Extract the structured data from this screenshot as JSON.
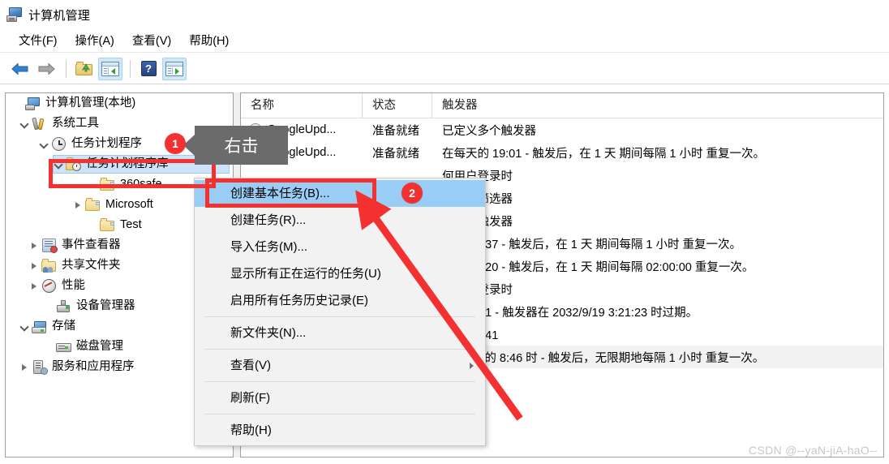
{
  "window": {
    "title": "计算机管理",
    "app_icon": "computer-management-icon"
  },
  "menubar": {
    "items": [
      {
        "label": "文件(F)"
      },
      {
        "label": "操作(A)"
      },
      {
        "label": "查看(V)"
      },
      {
        "label": "帮助(H)"
      }
    ]
  },
  "toolbar": {
    "buttons": [
      {
        "name": "back-icon",
        "label": ""
      },
      {
        "name": "forward-icon",
        "label": ""
      },
      {
        "name": "up-folder-icon",
        "label": ""
      },
      {
        "name": "show-hide-console-tree-icon",
        "label": ""
      },
      {
        "name": "help-icon",
        "label": "?"
      },
      {
        "name": "show-hide-action-pane-icon",
        "label": ""
      }
    ]
  },
  "tree": {
    "items": [
      {
        "label": "计算机管理(本地)",
        "icon": "computer-icon",
        "indent": 0,
        "expander": "none",
        "selected": false
      },
      {
        "label": "系统工具",
        "icon": "system-tools-icon",
        "indent": 1,
        "expander": "down",
        "selected": false
      },
      {
        "label": "任务计划程序",
        "icon": "task-scheduler-clock-icon",
        "indent": 2,
        "expander": "down",
        "selected": false
      },
      {
        "label": "任务计划程序库",
        "icon": "task-scheduler-library-folder-icon",
        "indent": 3,
        "expander": "down",
        "selected": true
      },
      {
        "label": "360safe",
        "icon": "folder-icon",
        "indent": 4,
        "expander": "none",
        "selected": false
      },
      {
        "label": "Microsoft",
        "icon": "folder-icon",
        "indent": 4,
        "expander": "right",
        "selected": false
      },
      {
        "label": "Test",
        "icon": "folder-icon",
        "indent": 4,
        "expander": "none",
        "selected": false
      },
      {
        "label": "事件查看器",
        "icon": "event-viewer-icon",
        "indent": 2,
        "expander": "right",
        "selected": false
      },
      {
        "label": "共享文件夹",
        "icon": "shared-folders-icon",
        "indent": 2,
        "expander": "right",
        "selected": false
      },
      {
        "label": "性能",
        "icon": "performance-icon",
        "indent": 2,
        "expander": "right",
        "selected": false
      },
      {
        "label": "设备管理器",
        "icon": "device-manager-icon",
        "indent": 2,
        "expander": "none",
        "selected": false
      },
      {
        "label": "存储",
        "icon": "storage-icon",
        "indent": 1,
        "expander": "down",
        "selected": false
      },
      {
        "label": "磁盘管理",
        "icon": "disk-management-icon",
        "indent": 2,
        "expander": "none",
        "selected": false
      },
      {
        "label": "服务和应用程序",
        "icon": "services-and-applications-icon",
        "indent": 1,
        "expander": "right",
        "selected": false
      }
    ]
  },
  "list": {
    "columns": [
      {
        "label": "名称"
      },
      {
        "label": "状态"
      },
      {
        "label": "触发器"
      }
    ],
    "rows": [
      {
        "name": "GoogleUpd...",
        "status": "准备就绪",
        "trigger": "已定义多个触发器"
      },
      {
        "name": "GoogleUpd...",
        "status": "准备就绪",
        "trigger": "在每天的 19:01 - 触发后，在 1 天 期间每隔 1 小时 重复一次。"
      },
      {
        "name": "",
        "status": "",
        "trigger": "何用户登录时"
      },
      {
        "name": "",
        "status": "",
        "trigger": "义事件筛选器"
      },
      {
        "name": "",
        "status": "",
        "trigger": "义多个触发器"
      },
      {
        "name": "",
        "status": "",
        "trigger": "天的 20:37 - 触发后，在 1 天 期间每隔 1 小时 重复一次。"
      },
      {
        "name": "",
        "status": "",
        "trigger": "天的 13:20 - 触发后，在 1 天 期间每隔 02:00:00 重复一次。"
      },
      {
        "name": "",
        "status": "",
        "trigger": "何用户登录时"
      },
      {
        "name": "",
        "status": "",
        "trigger": "天的 3:21 - 触发器在 2032/9/19 3:21:23 时过期。"
      },
      {
        "name": "",
        "status": "",
        "trigger": "天的 15:41"
      },
      {
        "name": "",
        "status": "",
        "trigger": "22/9/10 的 8:46 时 - 触发后，无限期地每隔 1 小时 重复一次。"
      }
    ]
  },
  "context_menu": {
    "items": [
      {
        "label": "创建基本任务(B)...",
        "highlighted": true,
        "separator_after": false,
        "submenu": false
      },
      {
        "label": "创建任务(R)...",
        "highlighted": false,
        "separator_after": false,
        "submenu": false
      },
      {
        "label": "导入任务(M)...",
        "highlighted": false,
        "separator_after": false,
        "submenu": false
      },
      {
        "label": "显示所有正在运行的任务(U)",
        "highlighted": false,
        "separator_after": false,
        "submenu": false
      },
      {
        "label": "启用所有任务历史记录(E)",
        "highlighted": false,
        "separator_after": true,
        "submenu": false
      },
      {
        "label": "新文件夹(N)...",
        "highlighted": false,
        "separator_after": true,
        "submenu": false
      },
      {
        "label": "查看(V)",
        "highlighted": false,
        "separator_after": true,
        "submenu": true
      },
      {
        "label": "刷新(F)",
        "highlighted": false,
        "separator_after": true,
        "submenu": false
      },
      {
        "label": "帮助(H)",
        "highlighted": false,
        "separator_after": false,
        "submenu": false
      }
    ]
  },
  "annotations": {
    "badge_1": "1",
    "badge_2": "2",
    "tooltip_right_click": "右击",
    "accent_color": "#f33131",
    "highlight_color": "#99cdf5",
    "tooltip_bg": "#6b6b6b"
  },
  "watermark": {
    "text": "CSDN @--yaN-jiA-haO--"
  }
}
